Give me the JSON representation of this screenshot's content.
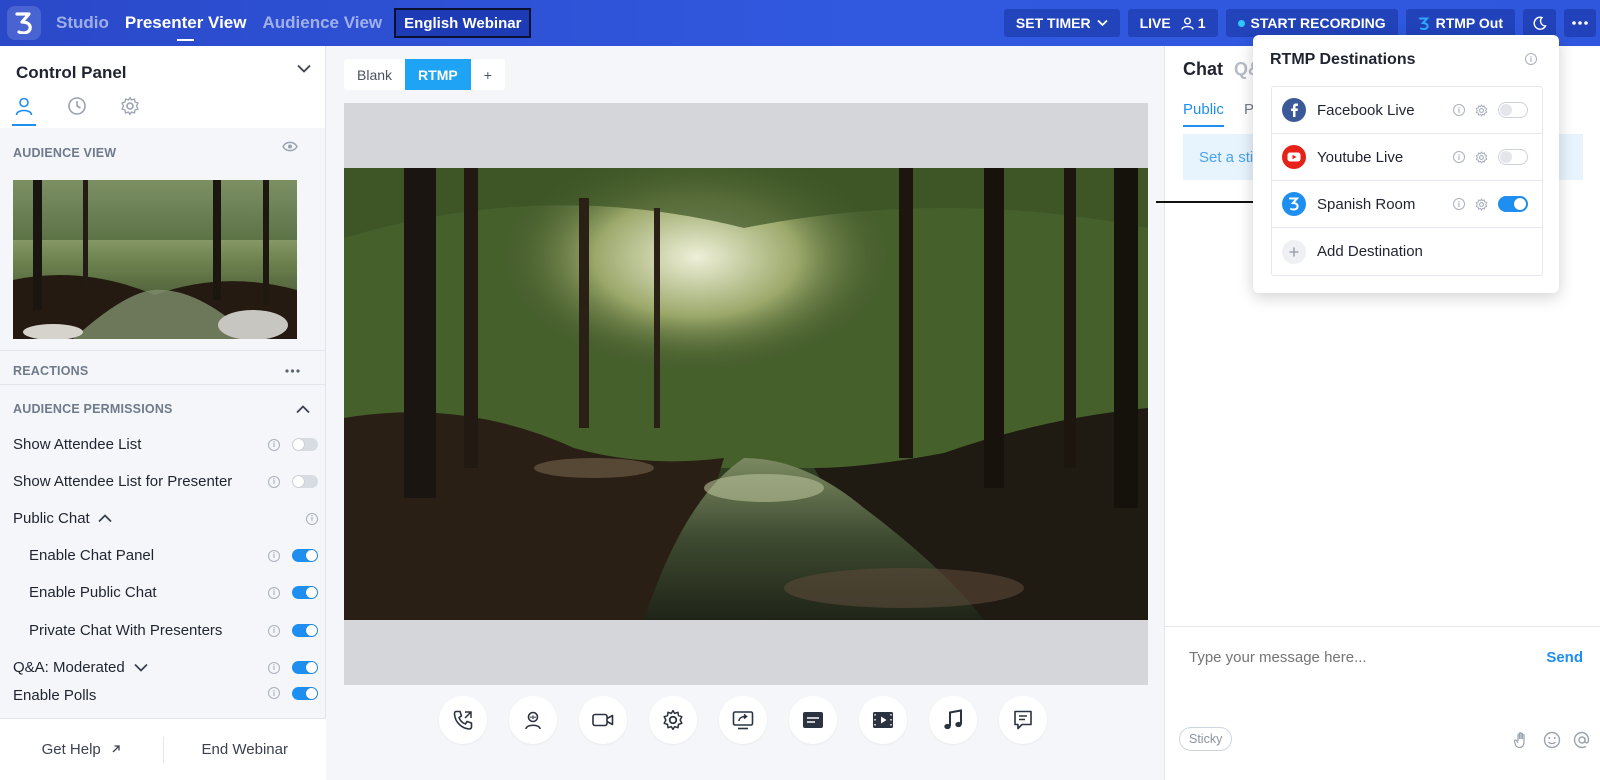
{
  "topbar": {
    "nav": [
      "Studio",
      "Presenter View",
      "Audience View"
    ],
    "webinar_name": "English Webinar",
    "set_timer": "SET TIMER",
    "live": "LIVE",
    "viewer_count": "1",
    "start_recording": "START RECORDING",
    "rtmp_out": "RTMP Out"
  },
  "control_panel": {
    "title": "Control Panel",
    "audience_view_label": "AUDIENCE VIEW",
    "reactions_label": "REACTIONS",
    "permissions_label": "AUDIENCE PERMISSIONS",
    "permissions": [
      {
        "label": "Show Attendee List",
        "on": false
      },
      {
        "label": "Show Attendee List for Presenter",
        "on": false
      },
      {
        "label": "Public Chat",
        "on": null
      },
      {
        "label": "Enable Chat Panel",
        "on": true
      },
      {
        "label": "Enable Public Chat",
        "on": true
      },
      {
        "label": "Private Chat With Presenters",
        "on": true
      },
      {
        "label": "Q&A: Moderated",
        "on": true
      },
      {
        "label": "Enable Polls",
        "on": true
      }
    ],
    "get_help": "Get Help",
    "end_webinar": "End Webinar"
  },
  "scenes": {
    "tabs": [
      "Blank",
      "RTMP",
      "+"
    ],
    "active": "RTMP"
  },
  "chat": {
    "title": "Chat",
    "qa_tab": "Q&",
    "tab_public": "Public",
    "tab_private": "P",
    "sticky_banner": "Set a sticky message",
    "input_placeholder": "Type your message here...",
    "send": "Send",
    "sticky_pill": "Sticky"
  },
  "rtmp_popup": {
    "title": "RTMP Destinations",
    "destinations": [
      {
        "name": "Facebook Live",
        "on": false,
        "color": "#3b5998"
      },
      {
        "name": "Youtube Live",
        "on": false,
        "color": "#e62117"
      },
      {
        "name": "Spanish Room",
        "on": true,
        "color": "#1e8ff0"
      }
    ],
    "add_destination": "Add Destination"
  },
  "colors": {
    "brand": "#3159e0",
    "accent": "#1e8ff0"
  }
}
